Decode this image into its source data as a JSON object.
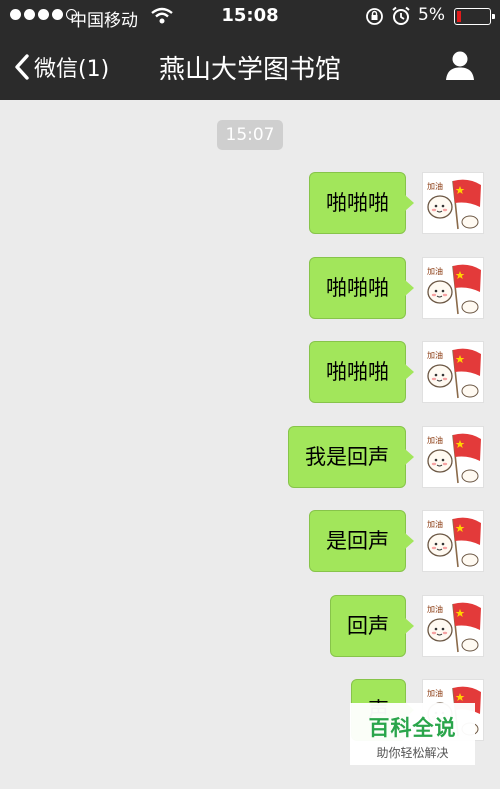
{
  "status_bar": {
    "carrier": "中国移动",
    "time": "15:08",
    "battery_percent": "5%",
    "battery_level": 0.05,
    "battery_color": "#e21b1b"
  },
  "nav": {
    "back_label": "微信(1)",
    "title": "燕山大学图书馆",
    "profile_icon": "person-icon"
  },
  "chat": {
    "timestamp": "15:07",
    "bubble_color": "#a2e65b",
    "messages": [
      {
        "text": "啪啪啪"
      },
      {
        "text": "啪啪啪"
      },
      {
        "text": "啪啪啪"
      },
      {
        "text": "我是回声"
      },
      {
        "text": "是回声"
      },
      {
        "text": "回声"
      },
      {
        "text": "声"
      }
    ],
    "avatar_icon": "sticker-avatar-with-flag",
    "avatar_text": "加油"
  },
  "watermark": {
    "title": "百科全说",
    "subtitle": "助你轻松解决"
  }
}
